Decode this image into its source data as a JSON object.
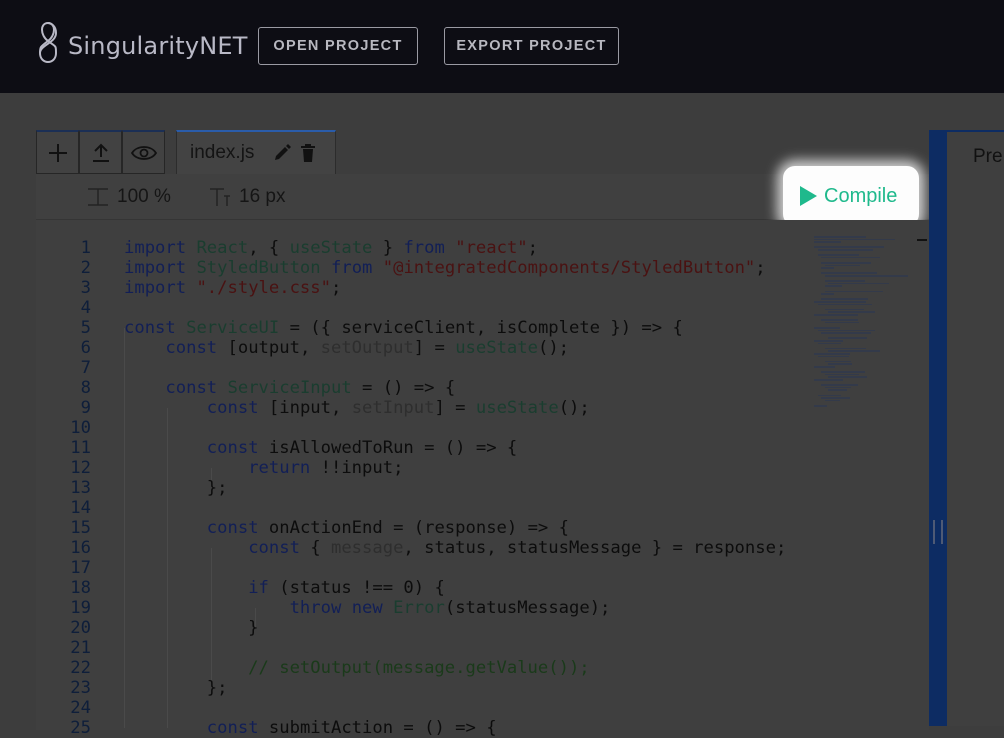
{
  "header": {
    "brand": "SingularityNET",
    "open_project": "OPEN PROJECT",
    "export_project": "EXPORT PROJECT"
  },
  "tabs": {
    "file_name": "index.js"
  },
  "toolbar": {
    "zoom": "100 %",
    "font_size": "16 px",
    "compile": "Compile"
  },
  "preview": {
    "tab_label": "Pre"
  },
  "icons": {
    "add": "plus-icon",
    "upload": "upload-icon",
    "view": "eye-icon",
    "rename": "pencil-icon",
    "delete": "trash-icon",
    "zoom": "zoom-icon",
    "font": "font-size-icon",
    "compile": "play-icon"
  },
  "colors": {
    "header_bg": "#0d0d14",
    "compile_green": "#1fb98c",
    "divider_blue": "#0d2c63"
  },
  "code_lines": [
    {
      "n": "1",
      "t": "import React, { useState } from \"react\";"
    },
    {
      "n": "2",
      "t": "import StyledButton from \"@integratedComponents/StyledButton\";"
    },
    {
      "n": "3",
      "t": "import \"./style.css\";"
    },
    {
      "n": "4",
      "t": ""
    },
    {
      "n": "5",
      "t": "const ServiceUI = ({ serviceClient, isComplete }) => {"
    },
    {
      "n": "6",
      "t": "    const [output, setOutput] = useState();"
    },
    {
      "n": "7",
      "t": ""
    },
    {
      "n": "8",
      "t": "    const ServiceInput = () => {"
    },
    {
      "n": "9",
      "t": "        const [input, setInput] = useState();"
    },
    {
      "n": "10",
      "t": ""
    },
    {
      "n": "11",
      "t": "        const isAllowedToRun = () => {"
    },
    {
      "n": "12",
      "t": "            return !!input;"
    },
    {
      "n": "13",
      "t": "        };"
    },
    {
      "n": "14",
      "t": ""
    },
    {
      "n": "15",
      "t": "        const onActionEnd = (response) => {"
    },
    {
      "n": "16",
      "t": "            const { message, status, statusMessage } = response;"
    },
    {
      "n": "17",
      "t": ""
    },
    {
      "n": "18",
      "t": "            if (status !== 0) {"
    },
    {
      "n": "19",
      "t": "                throw new Error(statusMessage);"
    },
    {
      "n": "20",
      "t": "            }"
    },
    {
      "n": "21",
      "t": ""
    },
    {
      "n": "22",
      "t": "            // setOutput(message.getValue());"
    },
    {
      "n": "23",
      "t": "        };"
    },
    {
      "n": "24",
      "t": ""
    },
    {
      "n": "25",
      "t": "        const submitAction = () => {"
    }
  ]
}
